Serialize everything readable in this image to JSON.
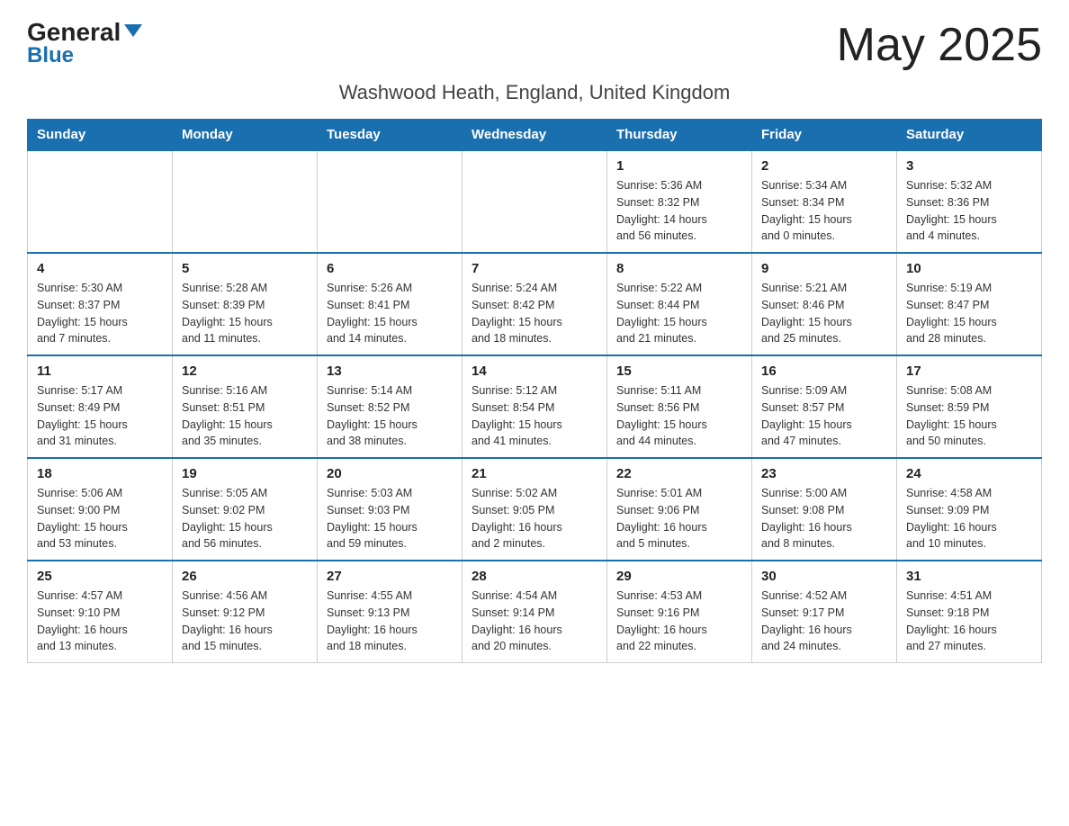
{
  "header": {
    "logo_general": "General",
    "logo_blue": "Blue",
    "month_title": "May 2025",
    "location": "Washwood Heath, England, United Kingdom"
  },
  "weekdays": [
    "Sunday",
    "Monday",
    "Tuesday",
    "Wednesday",
    "Thursday",
    "Friday",
    "Saturday"
  ],
  "rows": [
    [
      {
        "day": "",
        "info": ""
      },
      {
        "day": "",
        "info": ""
      },
      {
        "day": "",
        "info": ""
      },
      {
        "day": "",
        "info": ""
      },
      {
        "day": "1",
        "info": "Sunrise: 5:36 AM\nSunset: 8:32 PM\nDaylight: 14 hours\nand 56 minutes."
      },
      {
        "day": "2",
        "info": "Sunrise: 5:34 AM\nSunset: 8:34 PM\nDaylight: 15 hours\nand 0 minutes."
      },
      {
        "day": "3",
        "info": "Sunrise: 5:32 AM\nSunset: 8:36 PM\nDaylight: 15 hours\nand 4 minutes."
      }
    ],
    [
      {
        "day": "4",
        "info": "Sunrise: 5:30 AM\nSunset: 8:37 PM\nDaylight: 15 hours\nand 7 minutes."
      },
      {
        "day": "5",
        "info": "Sunrise: 5:28 AM\nSunset: 8:39 PM\nDaylight: 15 hours\nand 11 minutes."
      },
      {
        "day": "6",
        "info": "Sunrise: 5:26 AM\nSunset: 8:41 PM\nDaylight: 15 hours\nand 14 minutes."
      },
      {
        "day": "7",
        "info": "Sunrise: 5:24 AM\nSunset: 8:42 PM\nDaylight: 15 hours\nand 18 minutes."
      },
      {
        "day": "8",
        "info": "Sunrise: 5:22 AM\nSunset: 8:44 PM\nDaylight: 15 hours\nand 21 minutes."
      },
      {
        "day": "9",
        "info": "Sunrise: 5:21 AM\nSunset: 8:46 PM\nDaylight: 15 hours\nand 25 minutes."
      },
      {
        "day": "10",
        "info": "Sunrise: 5:19 AM\nSunset: 8:47 PM\nDaylight: 15 hours\nand 28 minutes."
      }
    ],
    [
      {
        "day": "11",
        "info": "Sunrise: 5:17 AM\nSunset: 8:49 PM\nDaylight: 15 hours\nand 31 minutes."
      },
      {
        "day": "12",
        "info": "Sunrise: 5:16 AM\nSunset: 8:51 PM\nDaylight: 15 hours\nand 35 minutes."
      },
      {
        "day": "13",
        "info": "Sunrise: 5:14 AM\nSunset: 8:52 PM\nDaylight: 15 hours\nand 38 minutes."
      },
      {
        "day": "14",
        "info": "Sunrise: 5:12 AM\nSunset: 8:54 PM\nDaylight: 15 hours\nand 41 minutes."
      },
      {
        "day": "15",
        "info": "Sunrise: 5:11 AM\nSunset: 8:56 PM\nDaylight: 15 hours\nand 44 minutes."
      },
      {
        "day": "16",
        "info": "Sunrise: 5:09 AM\nSunset: 8:57 PM\nDaylight: 15 hours\nand 47 minutes."
      },
      {
        "day": "17",
        "info": "Sunrise: 5:08 AM\nSunset: 8:59 PM\nDaylight: 15 hours\nand 50 minutes."
      }
    ],
    [
      {
        "day": "18",
        "info": "Sunrise: 5:06 AM\nSunset: 9:00 PM\nDaylight: 15 hours\nand 53 minutes."
      },
      {
        "day": "19",
        "info": "Sunrise: 5:05 AM\nSunset: 9:02 PM\nDaylight: 15 hours\nand 56 minutes."
      },
      {
        "day": "20",
        "info": "Sunrise: 5:03 AM\nSunset: 9:03 PM\nDaylight: 15 hours\nand 59 minutes."
      },
      {
        "day": "21",
        "info": "Sunrise: 5:02 AM\nSunset: 9:05 PM\nDaylight: 16 hours\nand 2 minutes."
      },
      {
        "day": "22",
        "info": "Sunrise: 5:01 AM\nSunset: 9:06 PM\nDaylight: 16 hours\nand 5 minutes."
      },
      {
        "day": "23",
        "info": "Sunrise: 5:00 AM\nSunset: 9:08 PM\nDaylight: 16 hours\nand 8 minutes."
      },
      {
        "day": "24",
        "info": "Sunrise: 4:58 AM\nSunset: 9:09 PM\nDaylight: 16 hours\nand 10 minutes."
      }
    ],
    [
      {
        "day": "25",
        "info": "Sunrise: 4:57 AM\nSunset: 9:10 PM\nDaylight: 16 hours\nand 13 minutes."
      },
      {
        "day": "26",
        "info": "Sunrise: 4:56 AM\nSunset: 9:12 PM\nDaylight: 16 hours\nand 15 minutes."
      },
      {
        "day": "27",
        "info": "Sunrise: 4:55 AM\nSunset: 9:13 PM\nDaylight: 16 hours\nand 18 minutes."
      },
      {
        "day": "28",
        "info": "Sunrise: 4:54 AM\nSunset: 9:14 PM\nDaylight: 16 hours\nand 20 minutes."
      },
      {
        "day": "29",
        "info": "Sunrise: 4:53 AM\nSunset: 9:16 PM\nDaylight: 16 hours\nand 22 minutes."
      },
      {
        "day": "30",
        "info": "Sunrise: 4:52 AM\nSunset: 9:17 PM\nDaylight: 16 hours\nand 24 minutes."
      },
      {
        "day": "31",
        "info": "Sunrise: 4:51 AM\nSunset: 9:18 PM\nDaylight: 16 hours\nand 27 minutes."
      }
    ]
  ]
}
